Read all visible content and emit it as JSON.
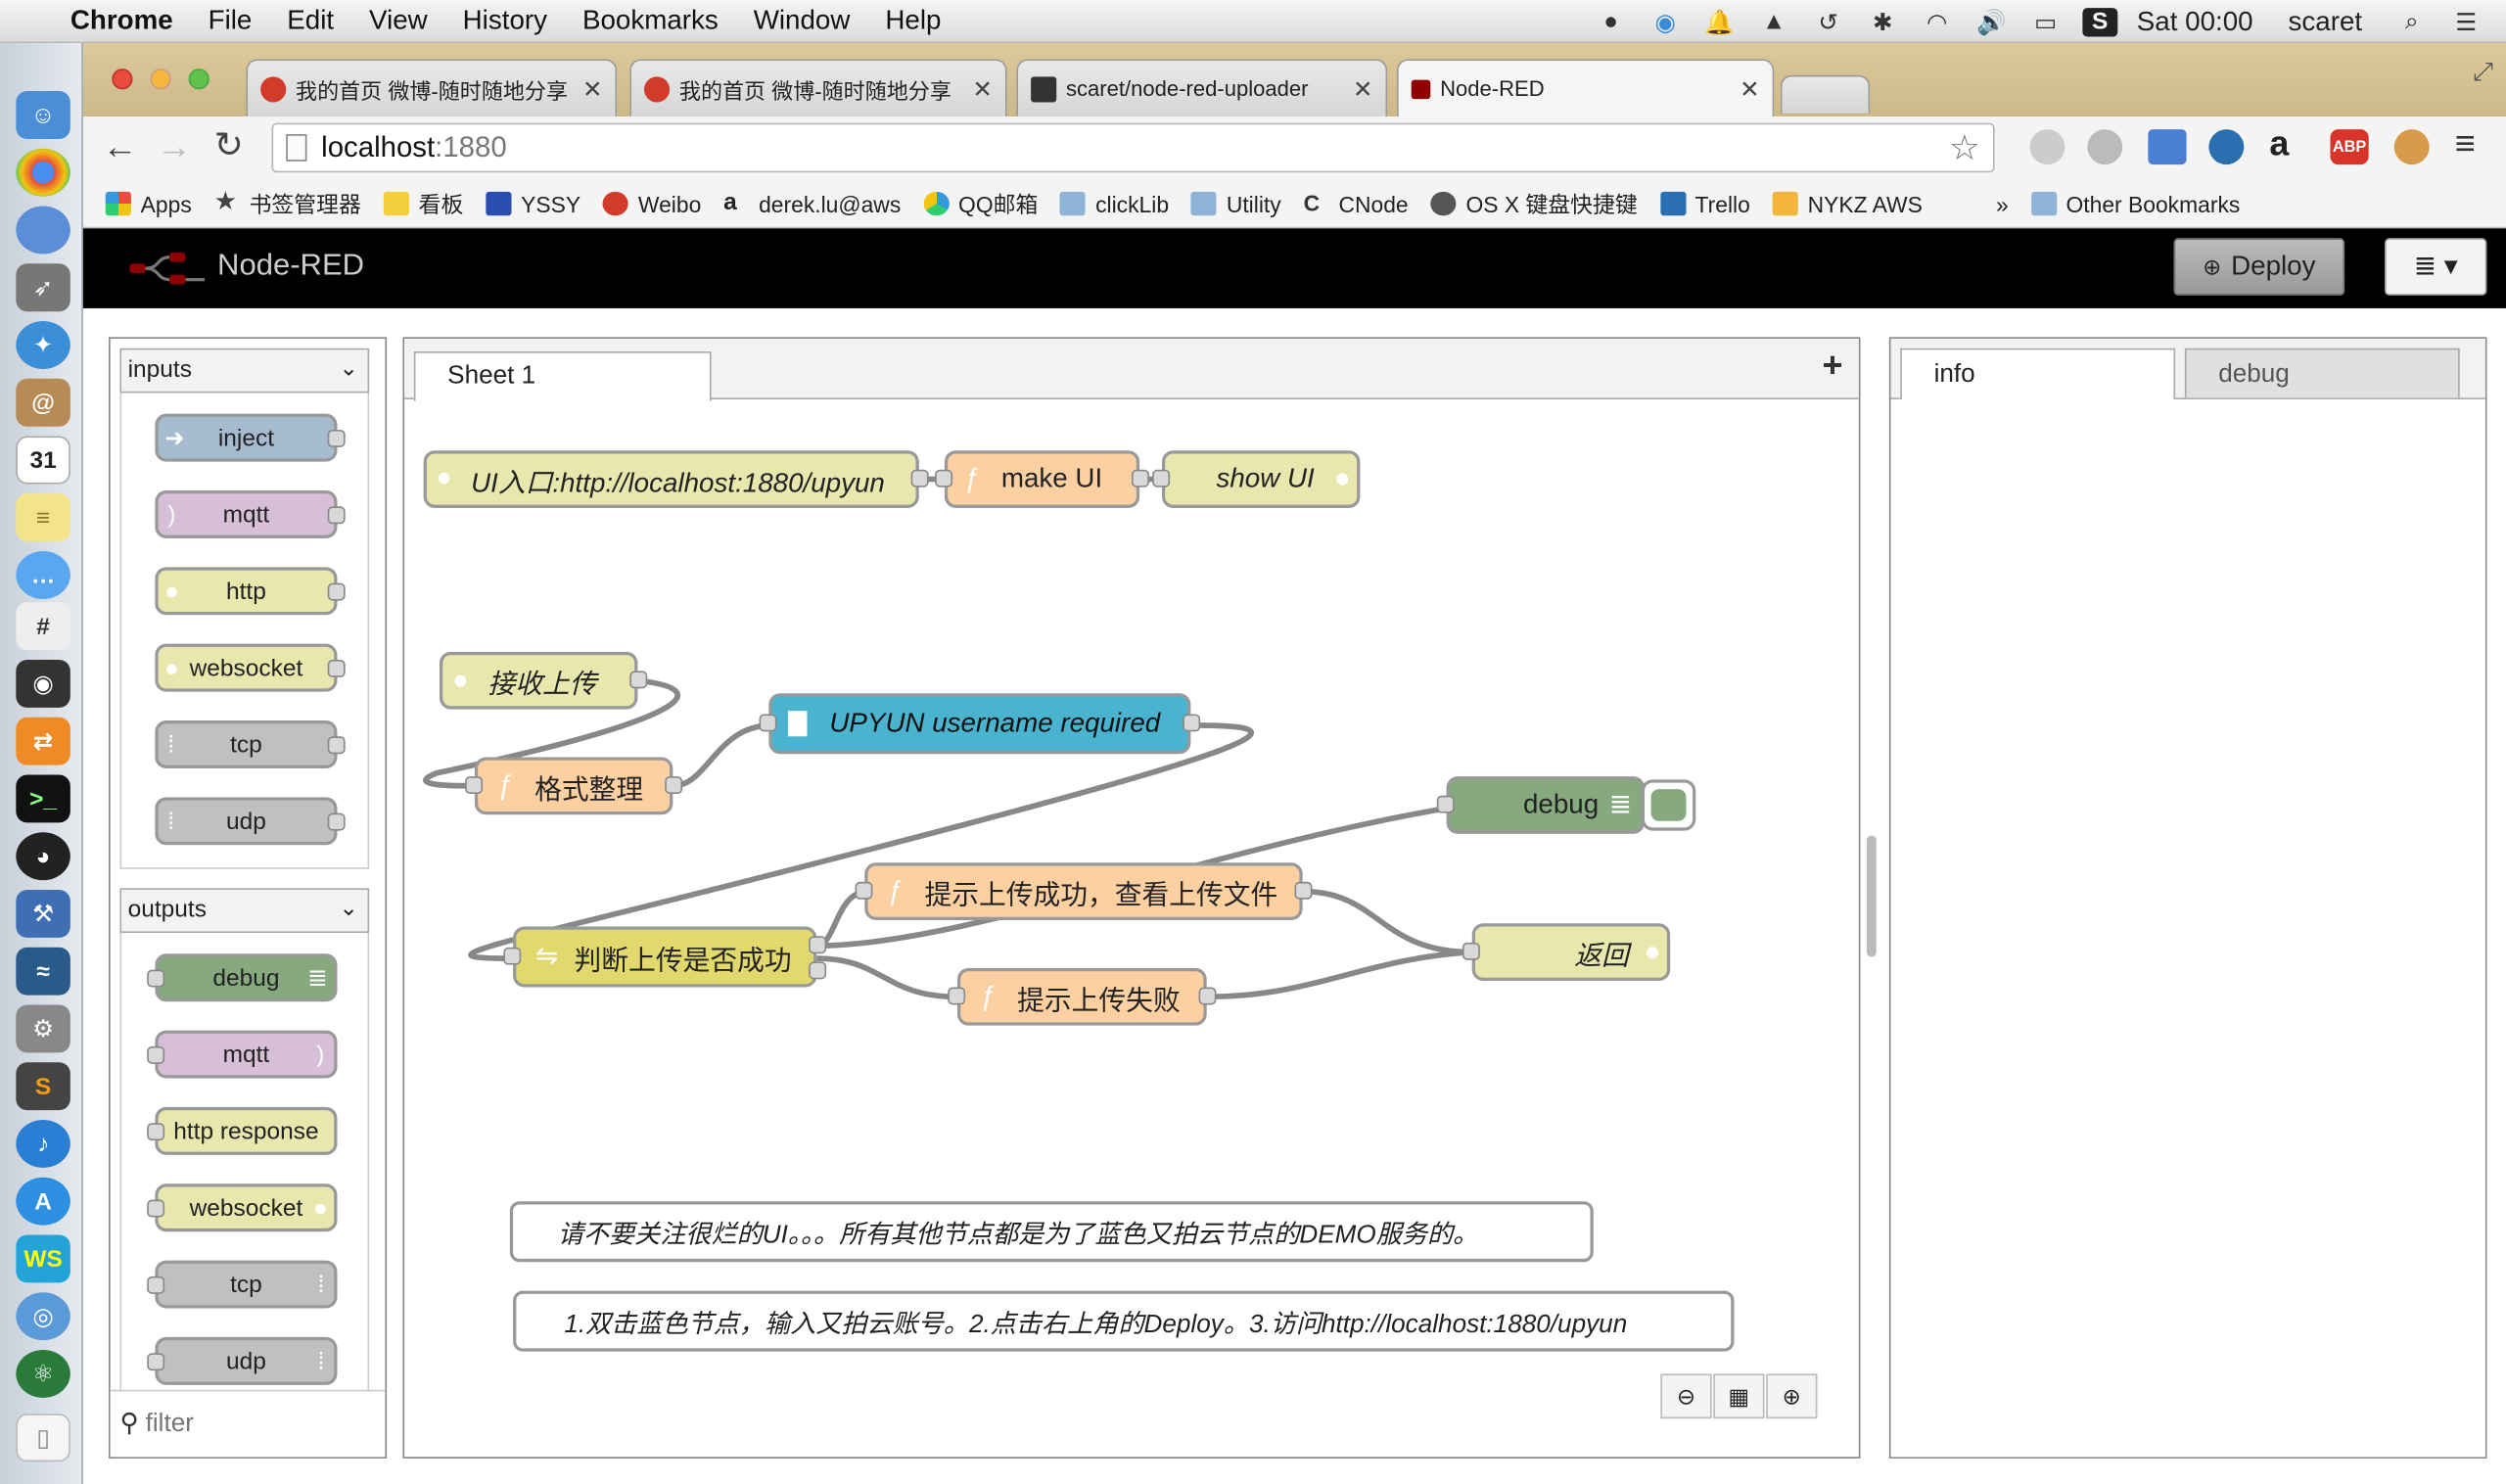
{
  "menubar": {
    "app": "Chrome",
    "items": [
      "File",
      "Edit",
      "View",
      "History",
      "Bookmarks",
      "Window",
      "Help"
    ],
    "clock": "Sat 00:00",
    "user": "scaret"
  },
  "browser": {
    "tabs": [
      {
        "title": "我的首页 微博-随时随地分享"
      },
      {
        "title": "我的首页 微博-随时随地分享"
      },
      {
        "title": "scaret/node-red-uploader"
      },
      {
        "title": "Node-RED"
      }
    ],
    "url_host": "localhost",
    "url_port": ":1880",
    "bookmarks": [
      "Apps",
      "书签管理器",
      "看板",
      "YSSY",
      "Weibo",
      "derek.lu@aws",
      "QQ邮箱",
      "clickLib",
      "Utility",
      "CNode",
      "OS X 键盘快捷键",
      "Trello",
      "NYKZ AWS"
    ],
    "bookmarks_more": "»",
    "other_bookmarks": "Other Bookmarks"
  },
  "nodered": {
    "title": "Node-RED",
    "deploy": "Deploy",
    "palette": {
      "inputs_label": "inputs",
      "inputs": [
        "inject",
        "mqtt",
        "http",
        "websocket",
        "tcp",
        "udp"
      ],
      "outputs_label": "outputs",
      "outputs": [
        "debug",
        "mqtt",
        "http response",
        "websocket",
        "tcp",
        "udp"
      ],
      "filter_placeholder": "filter"
    },
    "workspace": {
      "tab": "Sheet 1",
      "add": "+",
      "nodes": {
        "ui_entry": "UI入口:http://localhost:1880/upyun",
        "make_ui": "make UI",
        "show_ui": "show UI",
        "receive_upload": "接收上传",
        "format": "格式整理",
        "upyun": "UPYUN username required",
        "debug": "debug",
        "success": "提示上传成功，查看上传文件",
        "check": "判断上传是否成功",
        "fail": "提示上传失败",
        "return": "返回"
      },
      "comments": [
        "请不要关注很烂的UI。。。所有其他节点都是为了蓝色又拍云节点的DEMO服务的。",
        "1.双击蓝色节点，输入又拍云账号。2.点击右上角的Deploy。3.访问http://localhost:1880/upyun"
      ]
    },
    "sidebar": {
      "tabs": [
        "info",
        "debug"
      ]
    }
  },
  "colors": {
    "function": "#fdd0a2",
    "http": "#e7e7ae",
    "debug": "#87a980",
    "mqtt": "#d8bfd8",
    "tcp": "#c0c0c0",
    "upyun": "#4ab4d0"
  }
}
